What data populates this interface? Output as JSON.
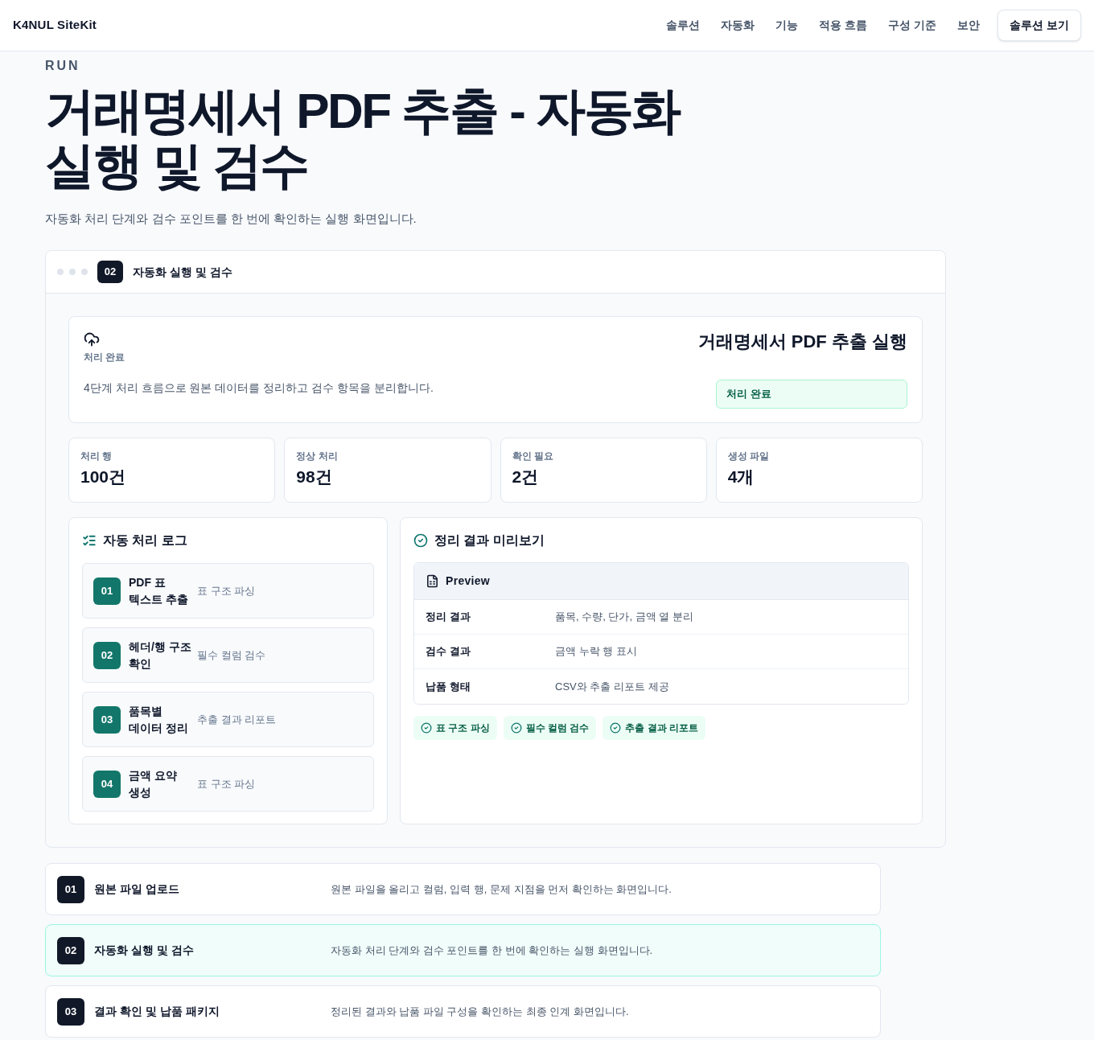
{
  "header": {
    "logo": "K4NUL SiteKit",
    "nav": [
      "솔루션",
      "자동화",
      "기능",
      "적용 흐름",
      "구성 기준",
      "보안"
    ],
    "cta": "솔루션 보기"
  },
  "hero": {
    "eyebrow": "RUN",
    "title": "거래명세서 PDF 추출 - 자동화 실행 및 검수",
    "subtitle": "자동화 처리 단계와 검수 포인트를 한 번에 확인하는 실행 화면입니다."
  },
  "panel": {
    "tab_number": "02",
    "tab_label": "자동화 실행 및 검수",
    "summary": {
      "status_label": "처리 완료",
      "description": "4단계 처리 흐름으로 원본 데이터를 정리하고 검수 항목을 분리합니다.",
      "title": "거래명세서 PDF 추출 실행",
      "status_badge": "처리 완료"
    },
    "metrics": [
      {
        "label": "처리 행",
        "value": "100건"
      },
      {
        "label": "정상 처리",
        "value": "98건"
      },
      {
        "label": "확인 필요",
        "value": "2건"
      },
      {
        "label": "생성 파일",
        "value": "4개"
      }
    ],
    "log": {
      "title": "자동 처리 로그",
      "steps": [
        {
          "number": "01",
          "title": "PDF 표 텍스트 추출",
          "detail": "표 구조 파싱"
        },
        {
          "number": "02",
          "title": "헤더/행 구조 확인",
          "detail": "필수 컬럼 검수"
        },
        {
          "number": "03",
          "title": "품목별 데이터 정리",
          "detail": "추출 결과 리포트"
        },
        {
          "number": "04",
          "title": "금액 요약 생성",
          "detail": "표 구조 파싱"
        }
      ]
    },
    "preview": {
      "title": "정리 결과 미리보기",
      "table_title": "Preview",
      "rows": [
        {
          "label": "정리 결과",
          "value": "품목, 수량, 단가, 금액 열 분리"
        },
        {
          "label": "검수 결과",
          "value": "금액 누락 행 표시"
        },
        {
          "label": "납품 형태",
          "value": "CSV와 추출 리포트 제공"
        }
      ],
      "chips": [
        "표 구조 파싱",
        "필수 컬럼 검수",
        "추출 결과 리포트"
      ]
    }
  },
  "steps": [
    {
      "number": "01",
      "title": "원본 파일 업로드",
      "description": "원본 파일을 올리고 컬럼, 입력 행, 문제 지점을 먼저 확인하는 화면입니다.",
      "selected": false
    },
    {
      "number": "02",
      "title": "자동화 실행 및 검수",
      "description": "자동화 처리 단계와 검수 포인트를 한 번에 확인하는 실행 화면입니다.",
      "selected": true
    },
    {
      "number": "03",
      "title": "결과 확인 및 납품 패키지",
      "description": "정리된 결과와 납품 파일 구성을 확인하는 최종 인계 화면입니다.",
      "selected": false
    }
  ]
}
